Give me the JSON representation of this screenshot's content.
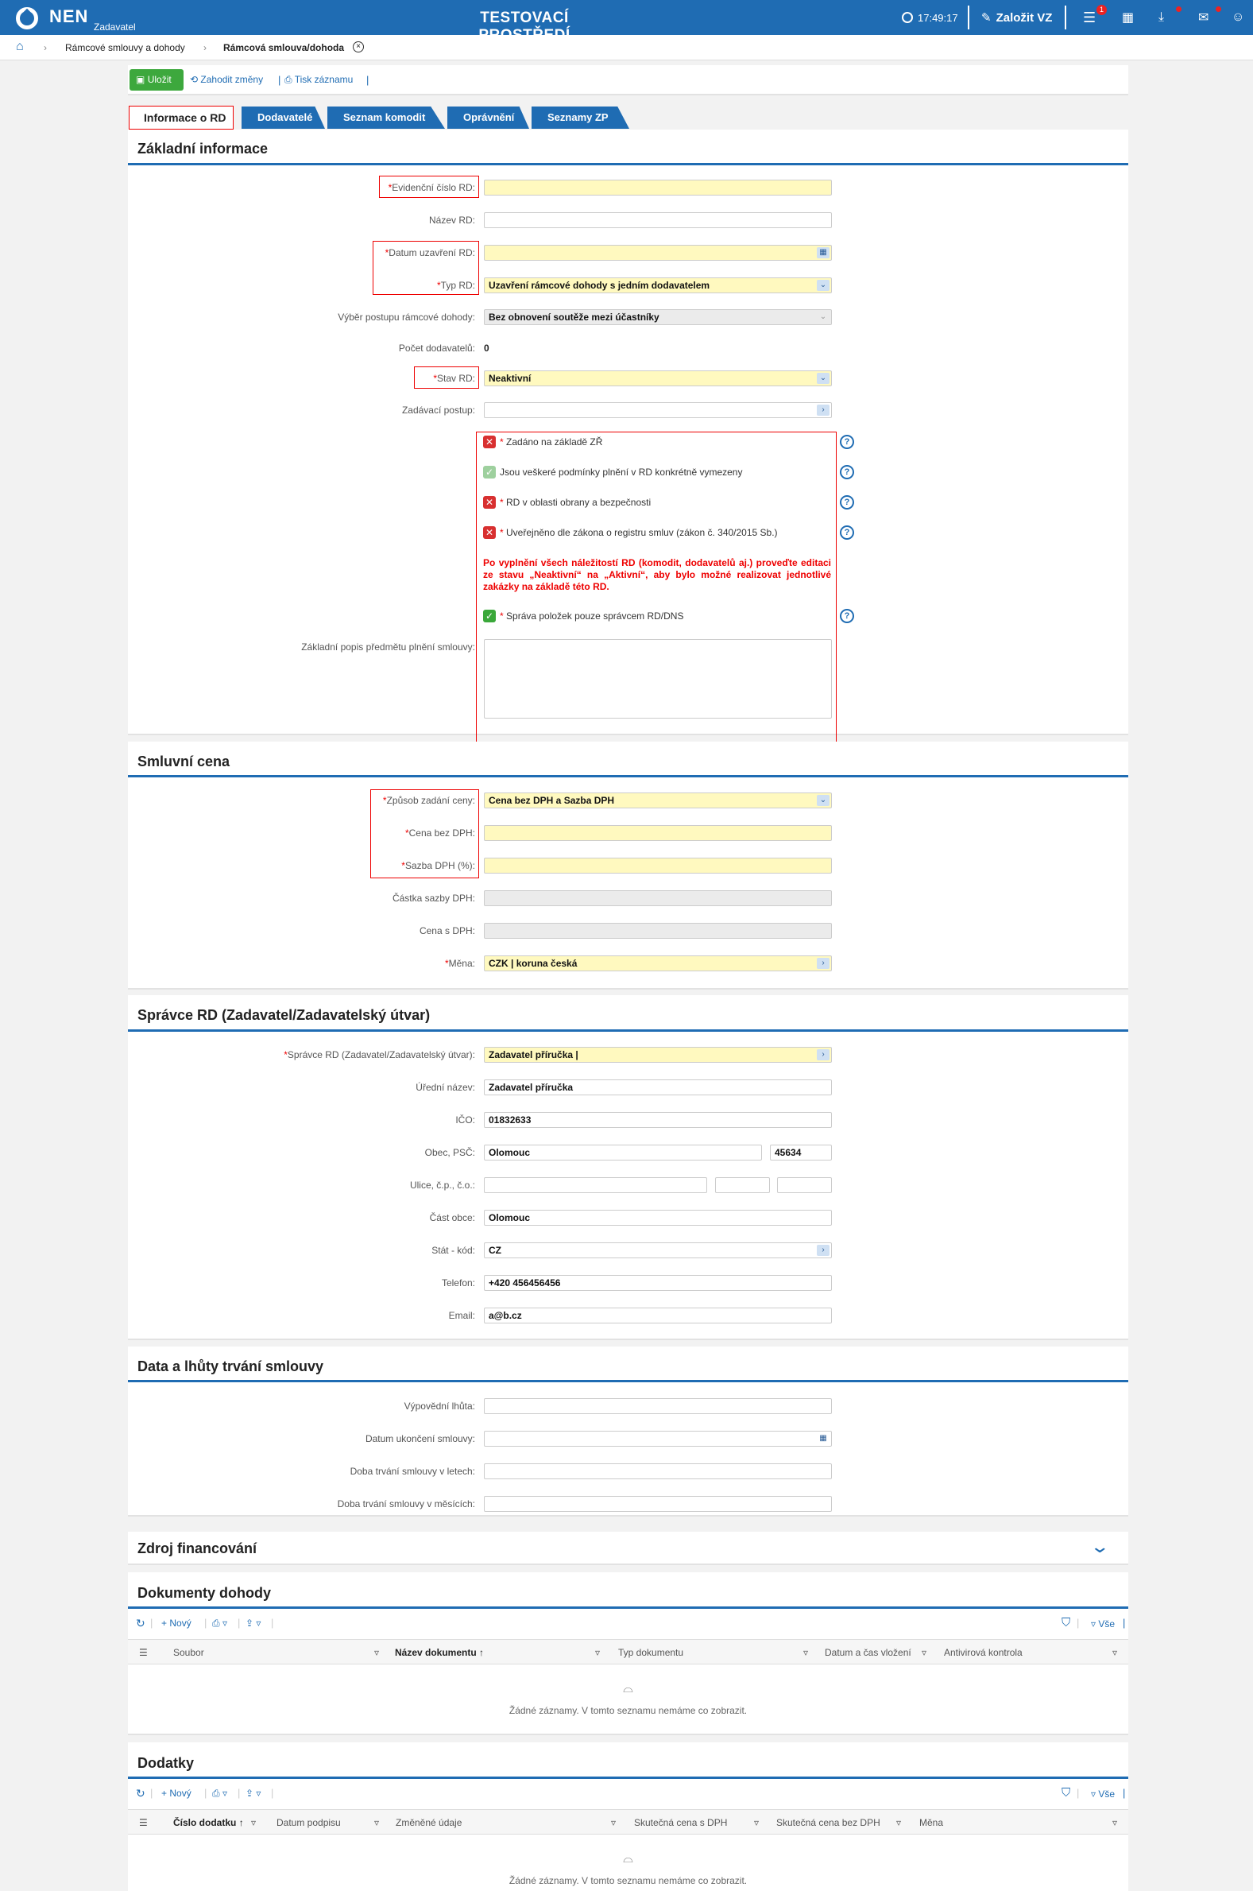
{
  "header": {
    "app_name": "NEN",
    "app_sub": "Zadavatel",
    "environment": "TESTOVACÍ PROSTŘEDÍ",
    "clock": "17:49:17",
    "create_label": "Založit VZ",
    "menu_badge": "1"
  },
  "breadcrumb": [
    "Rámcové smlouvy a dohody",
    "Rámcová smlouva/dohoda"
  ],
  "toolbar": {
    "save": "Uložit",
    "discard": "Zahodit změny",
    "print": "Tisk záznamu"
  },
  "tabs": [
    "Informace o RD",
    "Dodavatelé",
    "Seznam komodit",
    "Oprávnění",
    "Seznamy ZP"
  ],
  "basic": {
    "title": "Základní informace",
    "evid_label": "Evidenční číslo RD:",
    "evid_value": "",
    "name_label": "Název RD:",
    "name_value": "",
    "date_label": "Datum uzavření RD:",
    "date_value": "",
    "type_label": "Typ RD:",
    "type_value": "Uzavření rámcové dohody s jedním dodavatelem",
    "proc_label": "Výběr postupu rámcové dohody:",
    "proc_value": "Bez obnovení soutěže mezi účastníky",
    "count_label": "Počet dodavatelů:",
    "count_value": "0",
    "state_label": "Stav RD:",
    "state_value": "Neaktivní",
    "award_label": "Zadávací postup:",
    "award_value": "",
    "check1": "Zadáno na základě ZŘ",
    "check2": "Jsou veškeré podmínky plnění v RD konkrétně vymezeny",
    "check3": "RD v oblasti obrany a bezpečnosti",
    "check4": "Uveřejněno dle zákona o registru smluv (zákon č. 340/2015 Sb.)",
    "warning": "Po vyplnění všech náležitostí RD (komodit, dodavatelů aj.) proveďte editaci ze stavu „Neaktivní“ na „Aktivní“, aby bylo možné realizovat jednotlivé zakázky na základě této RD.",
    "check5": "Správa položek pouze správcem RD/DNS",
    "desc_label": "Základní popis předmětu plnění smlouvy:"
  },
  "price": {
    "title": "Smluvní cena",
    "mode_label": "Způsob zadání ceny:",
    "mode_value": "Cena bez DPH a Sazba DPH",
    "net_label": "Cena bez DPH:",
    "rate_label": "Sazba DPH (%):",
    "vat_label": "Částka sazby DPH:",
    "gross_label": "Cena s DPH:",
    "cur_label": "Měna:",
    "cur_value": "CZK | koruna česká"
  },
  "admin": {
    "title": "Správce RD (Zadavatel/Zadavatelský útvar)",
    "admin_label": "Správce RD (Zadavatel/Zadavatelský útvar):",
    "admin_value": "Zadavatel příručka |",
    "official_label": "Úřední název:",
    "official_value": "Zadavatel příručka",
    "ico_label": "IČO:",
    "ico_value": "01832633",
    "city_label": "Obec, PSČ:",
    "city_value": "Olomouc",
    "zip_value": "45634",
    "street_label": "Ulice, č.p., č.o.:",
    "part_label": "Část obce:",
    "part_value": "Olomouc",
    "country_label": "Stát - kód:",
    "country_value": "CZ",
    "phone_label": "Telefon:",
    "phone_value": "+420 456456456",
    "email_label": "Email:",
    "email_value": "a@b.cz"
  },
  "dates": {
    "title": "Data a lhůty trvání smlouvy",
    "notice_label": "Výpovědní lhůta:",
    "end_label": "Datum ukončení smlouvy:",
    "years_label": "Doba trvání smlouvy v letech:",
    "months_label": "Doba trvání smlouvy v měsících:"
  },
  "funding": {
    "title": "Zdroj financování"
  },
  "documents": {
    "title": "Dokumenty dohody",
    "new_label": "Nový",
    "all_label": "Vše",
    "columns": [
      "Soubor",
      "Název dokumentu",
      "Typ dokumentu",
      "Datum a čas vložení",
      "Antivirová kontrola"
    ],
    "empty": "Žádné záznamy. V tomto seznamu nemáme co zobrazit."
  },
  "amendments": {
    "title": "Dodatky",
    "new_label": "Nový",
    "all_label": "Vše",
    "columns": [
      "Číslo dodatku",
      "Datum podpisu",
      "Změněné údaje",
      "Skutečná cena s DPH",
      "Skutečná cena bez DPH",
      "Měna"
    ],
    "empty": "Žádné záznamy. V tomto seznamu nemáme co zobrazit."
  },
  "colors": {
    "brand": "#1f6cb3",
    "required_fill": "#fff9bf",
    "error": "#e00000",
    "ok": "#3aa83a"
  }
}
